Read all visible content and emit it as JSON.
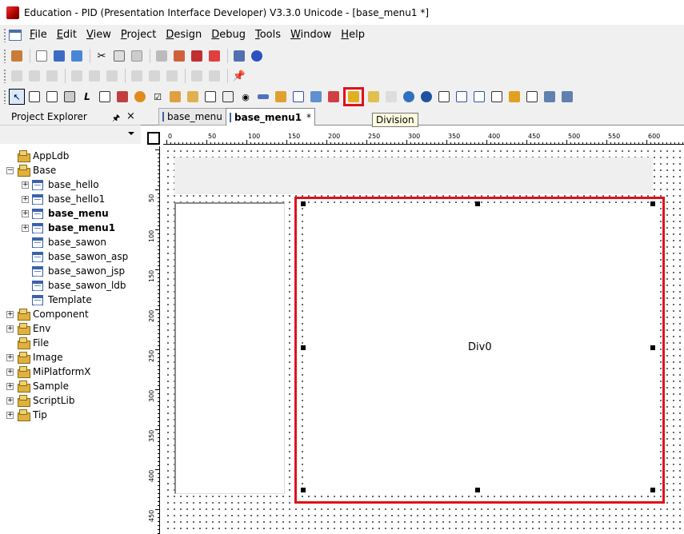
{
  "window": {
    "title": "Education - PID (Presentation Interface Developer) V3.3.0 Unicode - [base_menu1 *]"
  },
  "menu": [
    {
      "label": "File",
      "u": "F",
      "rest": "ile"
    },
    {
      "label": "Edit",
      "u": "E",
      "rest": "dit"
    },
    {
      "label": "View",
      "u": "V",
      "rest": "iew"
    },
    {
      "label": "Project",
      "u": "P",
      "rest": "roject"
    },
    {
      "label": "Design",
      "u": "D",
      "rest": "esign"
    },
    {
      "label": "Debug",
      "u": "D",
      "rest": "ebug"
    },
    {
      "label": "Tools",
      "u": "T",
      "rest": "ools"
    },
    {
      "label": "Window",
      "u": "W",
      "rest": "indow"
    },
    {
      "label": "Help",
      "u": "H",
      "rest": "elp"
    }
  ],
  "tooltip": "Division",
  "explorer": {
    "title": "Project Explorer",
    "pin": "ᵖ",
    "close": "×",
    "items": [
      {
        "label": "AppLdb",
        "icon": "folder-gear-icon",
        "expander": "",
        "bold": false
      },
      {
        "label": "Base",
        "icon": "folder-gear-icon",
        "expander": "−",
        "bold": false
      },
      {
        "label": "base_hello",
        "icon": "form-icon",
        "expander": "+",
        "bold": false
      },
      {
        "label": "base_hello1",
        "icon": "form-icon",
        "expander": "+",
        "bold": false
      },
      {
        "label": "base_menu",
        "icon": "form-icon",
        "expander": "+",
        "bold": true
      },
      {
        "label": "base_menu1",
        "icon": "form-icon",
        "expander": "+",
        "bold": true
      },
      {
        "label": "base_sawon",
        "icon": "form-icon",
        "expander": "",
        "bold": false
      },
      {
        "label": "base_sawon_asp",
        "icon": "form-icon",
        "expander": "",
        "bold": false
      },
      {
        "label": "base_sawon_jsp",
        "icon": "form-icon",
        "expander": "",
        "bold": false
      },
      {
        "label": "base_sawon_ldb",
        "icon": "form-icon",
        "expander": "",
        "bold": false
      },
      {
        "label": "Template",
        "icon": "form-icon",
        "expander": "",
        "bold": false
      },
      {
        "label": "Component",
        "icon": "folder-gear-icon",
        "expander": "+",
        "bold": false
      },
      {
        "label": "Env",
        "icon": "folder-gear-icon",
        "expander": "+",
        "bold": false
      },
      {
        "label": "File",
        "icon": "folder-gear-icon",
        "expander": "",
        "bold": false
      },
      {
        "label": "Image",
        "icon": "folder-gear-icon",
        "expander": "+",
        "bold": false
      },
      {
        "label": "MiPlatformX",
        "icon": "folder-gear-icon",
        "expander": "+",
        "bold": false
      },
      {
        "label": "Sample",
        "icon": "folder-gear-icon",
        "expander": "+",
        "bold": false
      },
      {
        "label": "ScriptLib",
        "icon": "folder-gear-icon",
        "expander": "+",
        "bold": false
      },
      {
        "label": "Tip",
        "icon": "folder-gear-icon",
        "expander": "+",
        "bold": false
      }
    ]
  },
  "tabs": [
    {
      "label": "base_menu",
      "active": false
    },
    {
      "label": "base_menu1",
      "active": true,
      "close": "*"
    }
  ],
  "ruler": {
    "h_labels": [
      "0",
      "50",
      "100",
      "150",
      "200",
      "250",
      "300",
      "350",
      "400",
      "450",
      "500",
      "550",
      "600"
    ],
    "v_labels": [
      "50",
      "100",
      "150",
      "200",
      "250",
      "300",
      "350",
      "400",
      "450"
    ]
  },
  "design": {
    "division_label": "Div0"
  },
  "colors": {
    "highlight": "#e0101c",
    "tooltip_bg": "#ffffe1"
  }
}
